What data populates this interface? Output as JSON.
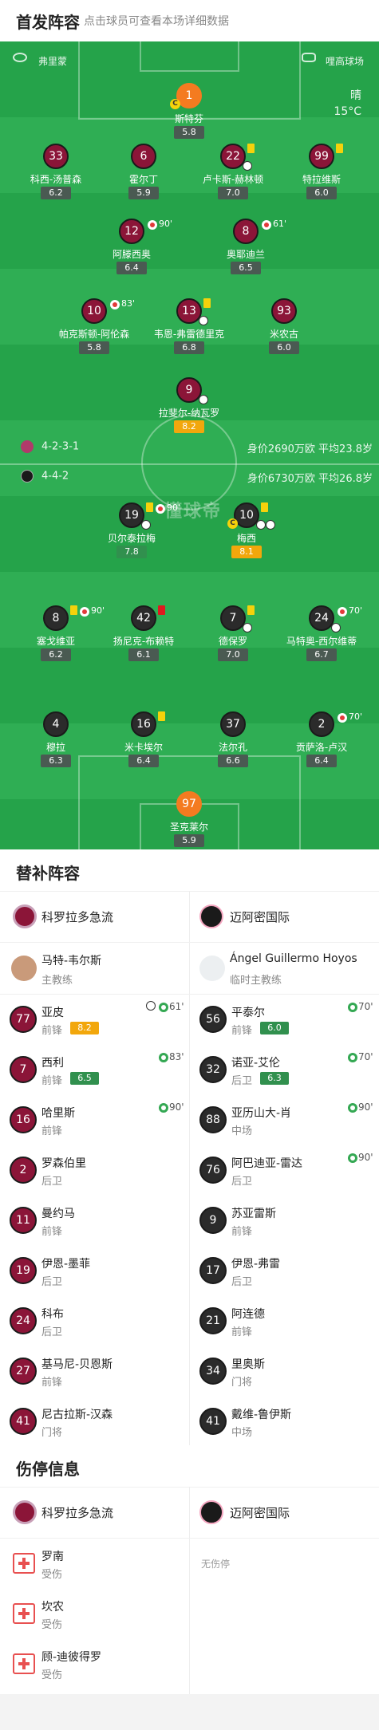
{
  "header": {
    "title": "首发阵容",
    "subtitle": "点击球员可查看本场详细数据"
  },
  "pitch": {
    "home_team_short": "弗里蒙",
    "stadium": "哩高球场",
    "weather": "晴",
    "temperature": "15°C",
    "watermark": "懂球帝",
    "home_formation": "4-2-3-1",
    "home_value": "身价2690万欧 平均23.8岁",
    "away_formation": "4-4-2",
    "away_value": "身价6730万欧 平均26.8岁",
    "colors": {
      "grass": "#25a34a",
      "home": "#8b1538",
      "away": "#2b2b2b",
      "gk": "#f47b20"
    }
  },
  "home_lineup": [
    {
      "num": "1",
      "name": "斯特芬",
      "rating": "5.8",
      "captain": "C"
    },
    {
      "num": "33",
      "name": "科西-汤普森",
      "rating": "6.2"
    },
    {
      "num": "6",
      "name": "霍尔丁",
      "rating": "5.9"
    },
    {
      "num": "22",
      "name": "卢卡斯-赫林顿",
      "rating": "7.0"
    },
    {
      "num": "99",
      "name": "特拉维斯",
      "rating": "6.0"
    },
    {
      "num": "12",
      "name": "阿滕西奥",
      "rating": "6.4",
      "sub_time": "90'"
    },
    {
      "num": "8",
      "name": "奥耶迪兰",
      "rating": "6.5",
      "sub_time": "61'"
    },
    {
      "num": "10",
      "name": "帕克斯顿-阿伦森",
      "rating": "5.8",
      "sub_time": "83'"
    },
    {
      "num": "13",
      "name": "韦恩-弗雷德里克",
      "rating": "6.8"
    },
    {
      "num": "93",
      "name": "米农古",
      "rating": "6.0"
    },
    {
      "num": "9",
      "name": "拉斐尔-纳瓦罗",
      "rating": "8.2"
    }
  ],
  "away_lineup": [
    {
      "num": "19",
      "name": "贝尔泰拉梅",
      "rating": "7.8",
      "sub_time": "90'"
    },
    {
      "num": "10",
      "name": "梅西",
      "rating": "8.1",
      "captain": "C"
    },
    {
      "num": "8",
      "name": "塞戈维亚",
      "rating": "6.2",
      "sub_time": "90'"
    },
    {
      "num": "42",
      "name": "扬尼克-布赖特",
      "rating": "6.1"
    },
    {
      "num": "7",
      "name": "德保罗",
      "rating": "7.0"
    },
    {
      "num": "24",
      "name": "马特奥-西尔维蒂",
      "rating": "6.7",
      "sub_time": "70'"
    },
    {
      "num": "4",
      "name": "穆拉",
      "rating": "6.3"
    },
    {
      "num": "16",
      "name": "米卡埃尔",
      "rating": "6.4"
    },
    {
      "num": "37",
      "name": "法尔孔",
      "rating": "6.6"
    },
    {
      "num": "2",
      "name": "贡萨洛-卢汉",
      "rating": "6.4",
      "sub_time": "70'"
    },
    {
      "num": "97",
      "name": "圣克莱尔",
      "rating": "5.9"
    }
  ],
  "subs": {
    "title": "替补阵容",
    "home_team": "科罗拉多急流",
    "away_team": "迈阿密国际",
    "home_coach": {
      "name": "马特-韦尔斯",
      "role": "主教练"
    },
    "away_coach": {
      "name": "Ángel Guillermo Hoyos",
      "role": "临时主教练"
    },
    "home": [
      {
        "num": "77",
        "name": "亚皮",
        "pos": "前锋",
        "rating": "8.2",
        "time": "61'"
      },
      {
        "num": "7",
        "name": "西利",
        "pos": "前锋",
        "rating": "6.5",
        "time": "83'"
      },
      {
        "num": "16",
        "name": "哈里斯",
        "pos": "前锋",
        "time": "90'"
      },
      {
        "num": "2",
        "name": "罗森伯里",
        "pos": "后卫"
      },
      {
        "num": "11",
        "name": "曼约马",
        "pos": "前锋"
      },
      {
        "num": "19",
        "name": "伊恩-墨菲",
        "pos": "后卫"
      },
      {
        "num": "24",
        "name": "科布",
        "pos": "后卫"
      },
      {
        "num": "27",
        "name": "基马尼-贝恩斯",
        "pos": "前锋"
      },
      {
        "num": "41",
        "name": "尼古拉斯-汉森",
        "pos": "门将"
      }
    ],
    "away": [
      {
        "num": "56",
        "name": "平泰尔",
        "pos": "前锋",
        "rating": "6.0",
        "time": "70'"
      },
      {
        "num": "32",
        "name": "诺亚-艾伦",
        "pos": "后卫",
        "rating": "6.3",
        "time": "70'"
      },
      {
        "num": "88",
        "name": "亚历山大-肖",
        "pos": "中场",
        "time": "90'"
      },
      {
        "num": "76",
        "name": "阿巴迪亚-雷达",
        "pos": "后卫",
        "time": "90'"
      },
      {
        "num": "9",
        "name": "苏亚雷斯",
        "pos": "前锋"
      },
      {
        "num": "17",
        "name": "伊恩-弗雷",
        "pos": "后卫"
      },
      {
        "num": "21",
        "name": "阿连德",
        "pos": "前锋"
      },
      {
        "num": "34",
        "name": "里奥斯",
        "pos": "门将"
      },
      {
        "num": "41",
        "name": "戴维-鲁伊斯",
        "pos": "中场"
      }
    ]
  },
  "injuries": {
    "title": "伤停信息",
    "home_team": "科罗拉多急流",
    "away_team": "迈阿密国际",
    "away_none": "无伤停",
    "home": [
      {
        "name": "罗南",
        "status": "受伤"
      },
      {
        "name": "坎农",
        "status": "受伤"
      },
      {
        "name": "顾-迪彼得罗",
        "status": "受伤"
      }
    ]
  }
}
